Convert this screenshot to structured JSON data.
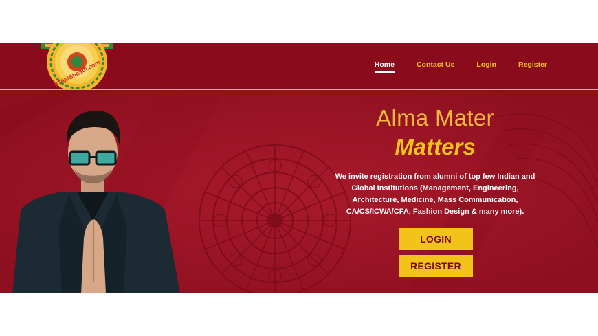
{
  "brand": {
    "logo_text": "IITIIMShaadi.com",
    "header_color": "#8a0c1c",
    "hero_color": "#9c1526",
    "accent_gold": "#f2c31a"
  },
  "nav": {
    "items": [
      {
        "label": "Home",
        "active": true
      },
      {
        "label": "Contact Us",
        "active": false
      },
      {
        "label": "Login",
        "active": false
      },
      {
        "label": "Register",
        "active": false
      }
    ]
  },
  "hero": {
    "headline_line1": "Alma Mater",
    "headline_line2": "Matters",
    "intro": "We invite registration from alumni of top few Indian and Global Institutions (Management, Engineering, Architecture, Medicine, Mass Communication, CA/CS/ICWA/CFA, Fashion Design & many more).",
    "login_button": "LOGIN",
    "register_button": "REGISTER"
  }
}
